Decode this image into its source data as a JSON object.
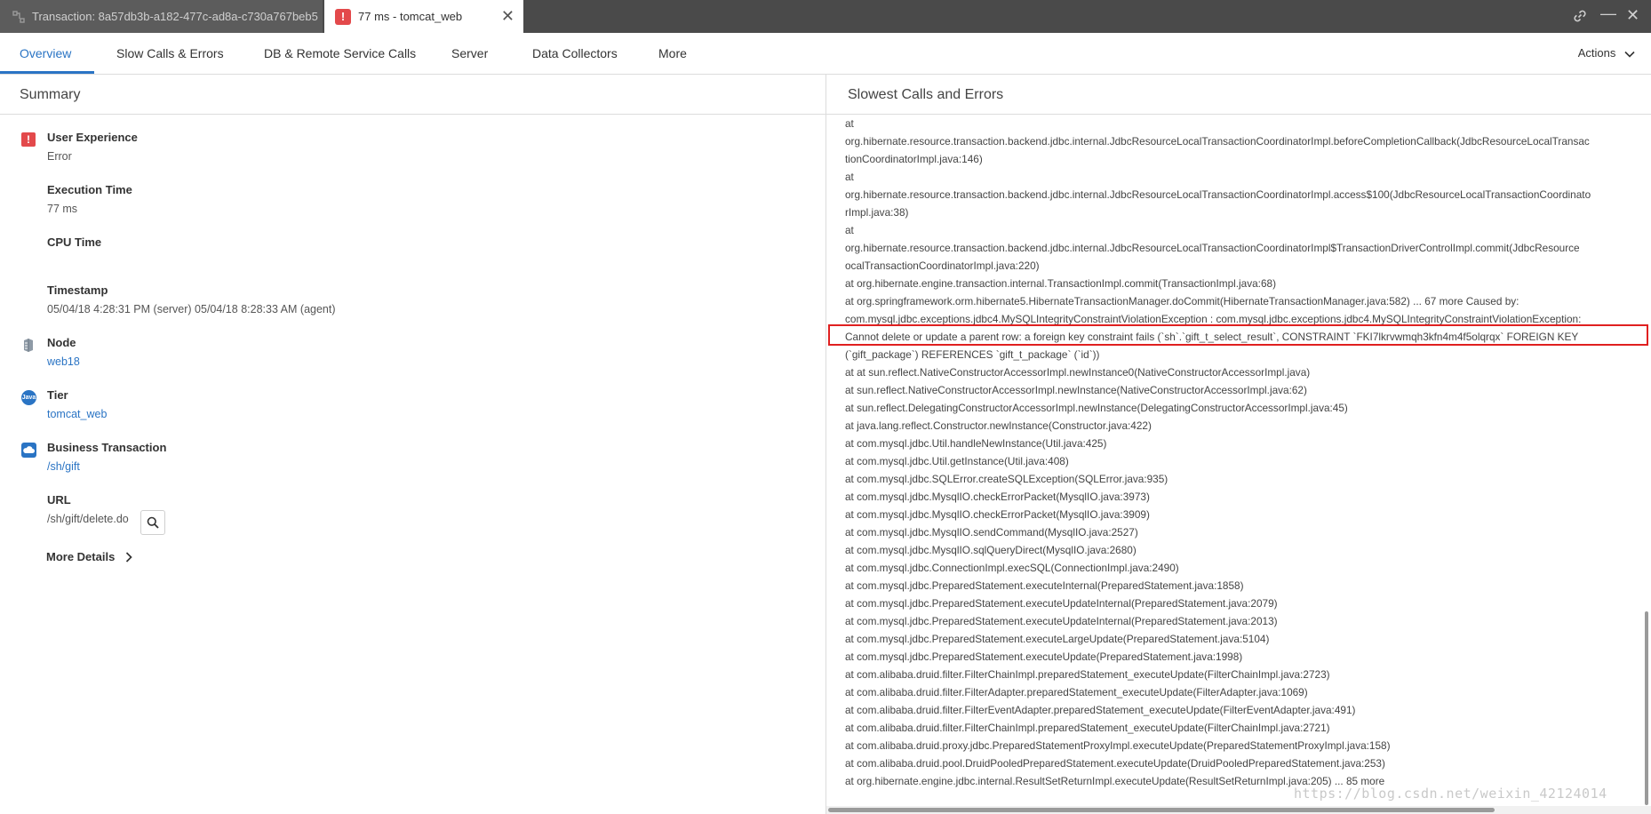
{
  "tabs": [
    {
      "label": "Transaction: 8a57db3b-a182-477c-ad8a-c730a767beb5",
      "icon": "transaction-flow-icon"
    },
    {
      "label": "77 ms - tomcat_web",
      "icon": "error-alert-icon",
      "close": "✕"
    }
  ],
  "window": {
    "link_icon": "link-icon",
    "minimize": "—",
    "close": "✕"
  },
  "nav": {
    "items": [
      "Overview",
      "Slow Calls & Errors",
      "DB & Remote Service Calls",
      "Server",
      "Data Collectors",
      "More"
    ],
    "actions": "Actions"
  },
  "summary": {
    "title": "Summary",
    "user_experience": {
      "label": "User Experience",
      "value": "Error"
    },
    "execution_time": {
      "label": "Execution Time",
      "value": "77 ms"
    },
    "cpu_time": {
      "label": "CPU Time",
      "value": ""
    },
    "timestamp": {
      "label": "Timestamp",
      "value": "05/04/18 4:28:31 PM (server) 05/04/18 8:28:33 AM (agent)"
    },
    "node": {
      "label": "Node",
      "value": "web18"
    },
    "tier": {
      "label": "Tier",
      "value": "tomcat_web",
      "icon_text": "Java"
    },
    "business_transaction": {
      "label": "Business Transaction",
      "value": "/sh/gift"
    },
    "url": {
      "label": "URL",
      "value": "/sh/gift/delete.do"
    },
    "more_details": "More Details"
  },
  "slowest": {
    "title": "Slowest Calls and Errors",
    "lines": [
      "at",
      "org.hibernate.resource.transaction.backend.jdbc.internal.JdbcResourceLocalTransactionCoordinatorImpl.beforeCompletionCallback(JdbcResourceLocalTransac",
      "tionCoordinatorImpl.java:146)",
      "at",
      "org.hibernate.resource.transaction.backend.jdbc.internal.JdbcResourceLocalTransactionCoordinatorImpl.access$100(JdbcResourceLocalTransactionCoordinato",
      "rImpl.java:38)",
      "at",
      "org.hibernate.resource.transaction.backend.jdbc.internal.JdbcResourceLocalTransactionCoordinatorImpl$TransactionDriverControlImpl.commit(JdbcResource",
      "ocalTransactionCoordinatorImpl.java:220)",
      "at org.hibernate.engine.transaction.internal.TransactionImpl.commit(TransactionImpl.java:68)",
      "at org.springframework.orm.hibernate5.HibernateTransactionManager.doCommit(HibernateTransactionManager.java:582) ... 67 more Caused by:",
      "com.mysql.jdbc.exceptions.jdbc4.MySQLIntegrityConstraintViolationException : com.mysql.jdbc.exceptions.jdbc4.MySQLIntegrityConstraintViolationException:",
      "Cannot delete or update a parent row: a foreign key constraint fails (`sh`.`gift_t_select_result`, CONSTRAINT `FKI7lkrvwmqh3kfn4m4f5olqrqx` FOREIGN KEY",
      "(`gift_package`) REFERENCES `gift_t_package` (`id`))",
      "at at sun.reflect.NativeConstructorAccessorImpl.newInstance0(NativeConstructorAccessorImpl.java)",
      "at sun.reflect.NativeConstructorAccessorImpl.newInstance(NativeConstructorAccessorImpl.java:62)",
      "at sun.reflect.DelegatingConstructorAccessorImpl.newInstance(DelegatingConstructorAccessorImpl.java:45)",
      "at java.lang.reflect.Constructor.newInstance(Constructor.java:422)",
      "at com.mysql.jdbc.Util.handleNewInstance(Util.java:425)",
      "at com.mysql.jdbc.Util.getInstance(Util.java:408)",
      "at com.mysql.jdbc.SQLError.createSQLException(SQLError.java:935)",
      "at com.mysql.jdbc.MysqlIO.checkErrorPacket(MysqlIO.java:3973)",
      "at com.mysql.jdbc.MysqlIO.checkErrorPacket(MysqlIO.java:3909)",
      "at com.mysql.jdbc.MysqlIO.sendCommand(MysqlIO.java:2527)",
      "at com.mysql.jdbc.MysqlIO.sqlQueryDirect(MysqlIO.java:2680)",
      "at com.mysql.jdbc.ConnectionImpl.execSQL(ConnectionImpl.java:2490)",
      "at com.mysql.jdbc.PreparedStatement.executeInternal(PreparedStatement.java:1858)",
      "at com.mysql.jdbc.PreparedStatement.executeUpdateInternal(PreparedStatement.java:2079)",
      "at com.mysql.jdbc.PreparedStatement.executeUpdateInternal(PreparedStatement.java:2013)",
      "at com.mysql.jdbc.PreparedStatement.executeLargeUpdate(PreparedStatement.java:5104)",
      "at com.mysql.jdbc.PreparedStatement.executeUpdate(PreparedStatement.java:1998)",
      "at com.alibaba.druid.filter.FilterChainImpl.preparedStatement_executeUpdate(FilterChainImpl.java:2723)",
      "at com.alibaba.druid.filter.FilterAdapter.preparedStatement_executeUpdate(FilterAdapter.java:1069)",
      "at com.alibaba.druid.filter.FilterEventAdapter.preparedStatement_executeUpdate(FilterEventAdapter.java:491)",
      "at com.alibaba.druid.filter.FilterChainImpl.preparedStatement_executeUpdate(FilterChainImpl.java:2721)",
      "at com.alibaba.druid.proxy.jdbc.PreparedStatementProxyImpl.executeUpdate(PreparedStatementProxyImpl.java:158)",
      "at com.alibaba.druid.pool.DruidPooledPreparedStatement.executeUpdate(DruidPooledPreparedStatement.java:253)",
      "at org.hibernate.engine.jdbc.internal.ResultSetReturnImpl.executeUpdate(ResultSetReturnImpl.java:205) ... 85 more"
    ]
  },
  "watermark": "https://blog.csdn.net/weixin_42124014",
  "colors": {
    "accent": "#2a74c4",
    "error": "#e3494b",
    "highlight_box": "#e02020",
    "tab_bar": "#4a4a4a"
  }
}
